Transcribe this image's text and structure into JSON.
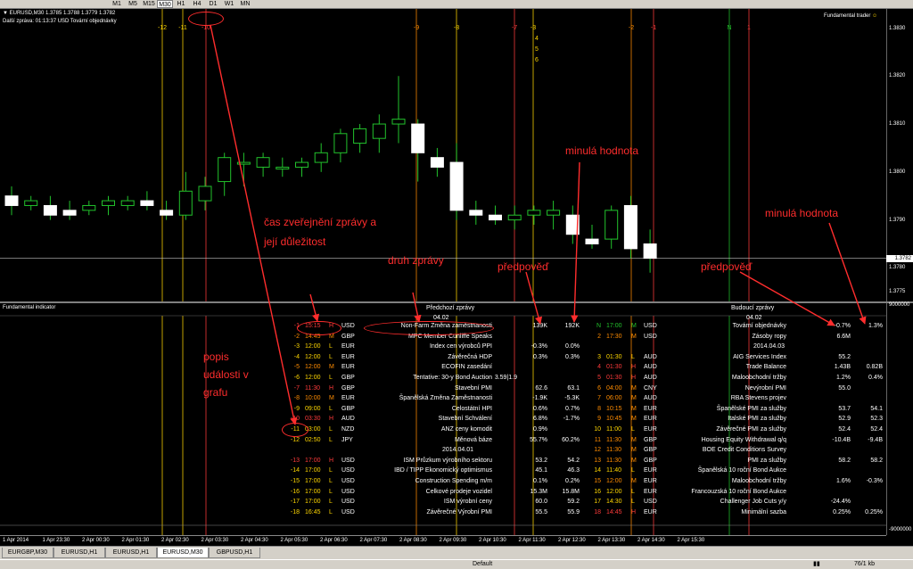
{
  "toolbar": {
    "timeframes": [
      "M1",
      "M5",
      "M15",
      "M30",
      "H1",
      "H4",
      "D1",
      "W1",
      "MN"
    ],
    "active": "M30"
  },
  "chart": {
    "symbol_line": "EURUSD,M30  1.3785 1.3788 1.3779 1.3782",
    "countdown_line": "Další zpráva: 01:13:37 USD Tovární objednávky",
    "ea_label": "Fundamental trader",
    "current_price": "1.3782",
    "y_labels": [
      "1.3830",
      "1.3820",
      "1.3810",
      "1.3800",
      "1.3790",
      "1.3780",
      "1.3775"
    ],
    "event_labels": [
      {
        "text": "-12",
        "color": "#ffd700"
      },
      {
        "text": "-11",
        "color": "#ffd700"
      },
      {
        "text": "-10",
        "color": "#ff3b3b"
      },
      {
        "text": "-9",
        "color": "#ff8c00"
      },
      {
        "text": "-8",
        "color": "#ffd700"
      },
      {
        "text": "-7",
        "color": "#ff3b3b"
      },
      {
        "text": "-3",
        "color": "#ffd700"
      },
      {
        "text": "-2",
        "color": "#ff8c00"
      },
      {
        "text": "-1",
        "color": "#ff3b3b"
      },
      {
        "text": "N",
        "color": "#22c22c"
      },
      {
        "text": "1",
        "color": "#ff3b3b"
      }
    ],
    "future_labels": [
      "4",
      "5",
      "6"
    ]
  },
  "indicator": {
    "title": "Fundamental indicator",
    "axis_top": "9000000",
    "axis_bottom": "-9000000",
    "header_prev": "Předchozí zprávy",
    "header_next": "Budoucí zprávy",
    "date_prev": "04.02",
    "date_next": "04.02",
    "date_mid_prev": "2014.04.01",
    "date_mid_next": "2014.04.03",
    "prev_rows": [
      {
        "n": "-1",
        "t": "15:15",
        "imp": "H",
        "cur": "USD",
        "name": "Non-Farm Změna zaměstnanosti",
        "a": "",
        "f": "139K",
        "p": "192K",
        "color": "#ff3b3b"
      },
      {
        "n": "-2",
        "t": "14:45",
        "imp": "M",
        "cur": "GBP",
        "name": "MPC Member Cunliffe Speaks",
        "a": "",
        "f": "",
        "p": "",
        "color": "#ff8c00"
      },
      {
        "n": "-3",
        "t": "12:00",
        "imp": "L",
        "cur": "EUR",
        "name": "Index cen výrobců PPI",
        "a": "",
        "f": "-0.3%",
        "p": "0.0%",
        "color": "#ffd700"
      },
      {
        "n": "-4",
        "t": "12:00",
        "imp": "L",
        "cur": "EUR",
        "name": "Závěrečná HDP",
        "a": "",
        "f": "0.3%",
        "p": "0.3%",
        "color": "#ffd700"
      },
      {
        "n": "-5",
        "t": "12:00",
        "imp": "M",
        "cur": "EUR",
        "name": "ECOFIN zasedání",
        "a": "",
        "f": "",
        "p": "",
        "color": "#ff8c00"
      },
      {
        "n": "-6",
        "t": "12:00",
        "imp": "L",
        "cur": "GBP",
        "name": "Tentative: 30-y Bond Auction",
        "a": "3.59|1.9",
        "f": "",
        "p": "",
        "color": "#ffd700"
      },
      {
        "n": "-7",
        "t": "11:30",
        "imp": "H",
        "cur": "GBP",
        "name": "Stavební PMI",
        "a": "",
        "f": "62.6",
        "p": "63.1",
        "color": "#ff3b3b"
      },
      {
        "n": "-8",
        "t": "10:00",
        "imp": "M",
        "cur": "EUR",
        "name": "Španělská Změna Zaměstnanosti",
        "a": "",
        "f": "-1.9K",
        "p": "-5.3K",
        "color": "#ff8c00"
      },
      {
        "n": "-9",
        "t": "09:00",
        "imp": "L",
        "cur": "GBP",
        "name": "Celostátní HPI",
        "a": "",
        "f": "0.6%",
        "p": "0.7%",
        "color": "#ffd700"
      },
      {
        "n": "-10",
        "t": "03:30",
        "imp": "H",
        "cur": "AUD",
        "name": "Stavební Schválení",
        "a": "",
        "f": "6.8%",
        "p": "-1.7%",
        "color": "#ff3b3b"
      },
      {
        "n": "-11",
        "t": "03:00",
        "imp": "L",
        "cur": "NZD",
        "name": "ANZ ceny komodit",
        "a": "",
        "f": "0.9%",
        "p": "",
        "color": "#ffd700"
      },
      {
        "n": "-12",
        "t": "02:50",
        "imp": "L",
        "cur": "JPY",
        "name": "Měnová báze",
        "a": "",
        "f": "55.7%",
        "p": "60.2%",
        "color": "#ffd700"
      },
      {
        "n": "-13",
        "t": "17:00",
        "imp": "H",
        "cur": "USD",
        "name": "ISM Průzkum výrobního sektoru",
        "a": "",
        "f": "53.2",
        "p": "54.2",
        "color": "#ff3b3b"
      },
      {
        "n": "-14",
        "t": "17:00",
        "imp": "L",
        "cur": "USD",
        "name": "IBD / TIPP Ekonomický optimismus",
        "a": "",
        "f": "45.1",
        "p": "46.3",
        "color": "#ffd700"
      },
      {
        "n": "-15",
        "t": "17:00",
        "imp": "L",
        "cur": "USD",
        "name": "Construction Spending m/m",
        "a": "",
        "f": "0.1%",
        "p": "0.2%",
        "color": "#ffd700"
      },
      {
        "n": "-16",
        "t": "17:00",
        "imp": "L",
        "cur": "USD",
        "name": "Celkové prodeje vozidel",
        "a": "",
        "f": "15.3M",
        "p": "15.8M",
        "color": "#ffd700"
      },
      {
        "n": "-17",
        "t": "17:00",
        "imp": "L",
        "cur": "USD",
        "name": "ISM výrobní ceny",
        "a": "",
        "f": "60.0",
        "p": "59.2",
        "color": "#ffd700"
      },
      {
        "n": "-18",
        "t": "16:45",
        "imp": "L",
        "cur": "USD",
        "name": "Závěrečné Výrobní PMI",
        "a": "",
        "f": "55.5",
        "p": "55.9",
        "color": "#ffd700"
      }
    ],
    "next_rows": [
      {
        "n": "N",
        "t": "17:00",
        "imp": "M",
        "cur": "USD",
        "name": "Tovární objednávky",
        "f": "-0.7%",
        "p": "1.3%",
        "color": "#22c22c"
      },
      {
        "n": "2",
        "t": "17:30",
        "imp": "M",
        "cur": "USD",
        "name": "Zásoby ropy",
        "f": "6.6M",
        "p": "",
        "color": "#ff8c00"
      },
      {
        "n": "3",
        "t": "01:30",
        "imp": "L",
        "cur": "AUD",
        "name": "AIG Services Index",
        "f": "55.2",
        "p": "",
        "color": "#ffd700"
      },
      {
        "n": "4",
        "t": "01:30",
        "imp": "H",
        "cur": "AUD",
        "name": "Trade Balance",
        "f": "1.43B",
        "p": "0.82B",
        "color": "#ff3b3b"
      },
      {
        "n": "5",
        "t": "01:30",
        "imp": "H",
        "cur": "AUD",
        "name": "Maloobchodní tržby",
        "f": "1.2%",
        "p": "0.4%",
        "color": "#ff3b3b"
      },
      {
        "n": "6",
        "t": "04:00",
        "imp": "M",
        "cur": "CNY",
        "name": "Nevýrobní PMI",
        "f": "55.0",
        "p": "",
        "color": "#ff8c00"
      },
      {
        "n": "7",
        "t": "06:00",
        "imp": "M",
        "cur": "AUD",
        "name": "RBA Stevens projev",
        "f": "",
        "p": "",
        "color": "#ff8c00"
      },
      {
        "n": "8",
        "t": "10:15",
        "imp": "M",
        "cur": "EUR",
        "name": "Španělské PMI za služby",
        "f": "53.7",
        "p": "54.1",
        "color": "#ff8c00"
      },
      {
        "n": "9",
        "t": "10:45",
        "imp": "M",
        "cur": "EUR",
        "name": "Italské PMI za služby",
        "f": "52.9",
        "p": "52.3",
        "color": "#ff8c00"
      },
      {
        "n": "10",
        "t": "11:00",
        "imp": "L",
        "cur": "EUR",
        "name": "Závěrečné PMI za služby",
        "f": "52.4",
        "p": "52.4",
        "color": "#ffd700"
      },
      {
        "n": "11",
        "t": "11:30",
        "imp": "M",
        "cur": "GBP",
        "name": "Housing Equity Withdrawal q/q",
        "f": "-10.4B",
        "p": "-9.4B",
        "color": "#ff8c00"
      },
      {
        "n": "12",
        "t": "11:30",
        "imp": "M",
        "cur": "GBP",
        "name": "BOE Credit Conditions Survey",
        "f": "",
        "p": "",
        "color": "#ff8c00"
      },
      {
        "n": "13",
        "t": "11:30",
        "imp": "M",
        "cur": "GBP",
        "name": "PMI za služby",
        "f": "58.2",
        "p": "58.2",
        "color": "#ff8c00"
      },
      {
        "n": "14",
        "t": "11:40",
        "imp": "L",
        "cur": "EUR",
        "name": "Španělská 10 roční Bond Aukce",
        "f": "",
        "p": "",
        "color": "#ffd700"
      },
      {
        "n": "15",
        "t": "12:00",
        "imp": "M",
        "cur": "EUR",
        "name": "Maloobchodní tržby",
        "f": "1.6%",
        "p": "-0.3%",
        "color": "#ff8c00"
      },
      {
        "n": "16",
        "t": "12:00",
        "imp": "L",
        "cur": "EUR",
        "name": "Francouzská 10 roční Bond Aukce",
        "f": "",
        "p": "",
        "color": "#ffd700"
      },
      {
        "n": "17",
        "t": "14:30",
        "imp": "L",
        "cur": "USD",
        "name": "Challenger Job Cuts y/y",
        "f": "-24.4%",
        "p": "",
        "color": "#ffd700"
      },
      {
        "n": "18",
        "t": "14:45",
        "imp": "H",
        "cur": "EUR",
        "name": "Minimální sazba",
        "f": "0.25%",
        "p": "0.25%",
        "color": "#ff3b3b"
      }
    ]
  },
  "time_labels": [
    "1 Apr 2014",
    "1 Apr 23:30",
    "2 Apr 00:30",
    "2 Apr 01:30",
    "2 Apr 02:30",
    "2 Apr 03:30",
    "2 Apr 04:30",
    "2 Apr 05:30",
    "2 Apr 06:30",
    "2 Apr 07:30",
    "2 Apr 08:30",
    "2 Apr 09:30",
    "2 Apr 10:30",
    "2 Apr 11:30",
    "2 Apr 12:30",
    "2 Apr 13:30",
    "2 Apr 14:30",
    "2 Apr 15:30"
  ],
  "tabs": [
    "EURGBP,M30",
    "EURUSD,H1",
    "EURUSD,H1",
    "EURUSD,M30",
    "GBPUSD,H1"
  ],
  "active_tab": "EURUSD,M30",
  "status": {
    "profile": "Default",
    "right": "76/1 kb"
  },
  "annotations": {
    "time_importance": "čas zveřejnění zprávy a její důležitost",
    "news_type": "druh zprávy",
    "forecast_left": "předpověď",
    "previous_left": "minulá hodnota",
    "forecast_right": "předpověď",
    "previous_right": "minulá hodnota",
    "event_desc": "popis události v grafu"
  },
  "chart_data": {
    "type": "candlestick",
    "symbol": "EURUSD",
    "timeframe": "M30",
    "ohlc_last": {
      "open": 1.3785,
      "high": 1.3788,
      "low": 1.3779,
      "close": 1.3782
    },
    "candles": [
      {
        "o": 1.3795,
        "h": 1.3797,
        "l": 1.3791,
        "c": 1.3793
      },
      {
        "o": 1.3793,
        "h": 1.3795,
        "l": 1.3792,
        "c": 1.3794
      },
      {
        "o": 1.3793,
        "h": 1.3795,
        "l": 1.379,
        "c": 1.3791
      },
      {
        "o": 1.3792,
        "h": 1.3794,
        "l": 1.379,
        "c": 1.3791
      },
      {
        "o": 1.3792,
        "h": 1.3794,
        "l": 1.3791,
        "c": 1.3793
      },
      {
        "o": 1.3793,
        "h": 1.3795,
        "l": 1.3791,
        "c": 1.3794
      },
      {
        "o": 1.3793,
        "h": 1.3795,
        "l": 1.3792,
        "c": 1.3794
      },
      {
        "o": 1.3794,
        "h": 1.3796,
        "l": 1.3792,
        "c": 1.3793
      },
      {
        "o": 1.3792,
        "h": 1.3794,
        "l": 1.379,
        "c": 1.3791
      },
      {
        "o": 1.3791,
        "h": 1.38,
        "l": 1.379,
        "c": 1.3796
      },
      {
        "o": 1.3794,
        "h": 1.3799,
        "l": 1.3792,
        "c": 1.3797
      },
      {
        "o": 1.3798,
        "h": 1.3804,
        "l": 1.3795,
        "c": 1.3803
      },
      {
        "o": 1.3802,
        "h": 1.3804,
        "l": 1.3797,
        "c": 1.3802
      },
      {
        "o": 1.3801,
        "h": 1.3804,
        "l": 1.3799,
        "c": 1.3803
      },
      {
        "o": 1.3801,
        "h": 1.3803,
        "l": 1.3799,
        "c": 1.3801
      },
      {
        "o": 1.3801,
        "h": 1.3803,
        "l": 1.3799,
        "c": 1.3802
      },
      {
        "o": 1.3802,
        "h": 1.3806,
        "l": 1.38,
        "c": 1.3804
      },
      {
        "o": 1.3804,
        "h": 1.3809,
        "l": 1.3802,
        "c": 1.3808
      },
      {
        "o": 1.3806,
        "h": 1.381,
        "l": 1.3804,
        "c": 1.3809
      },
      {
        "o": 1.3807,
        "h": 1.3812,
        "l": 1.3804,
        "c": 1.381
      },
      {
        "o": 1.381,
        "h": 1.382,
        "l": 1.3806,
        "c": 1.3811
      },
      {
        "o": 1.381,
        "h": 1.3811,
        "l": 1.3798,
        "c": 1.3804
      },
      {
        "o": 1.3803,
        "h": 1.3805,
        "l": 1.3799,
        "c": 1.3801
      },
      {
        "o": 1.3802,
        "h": 1.3806,
        "l": 1.379,
        "c": 1.3792
      },
      {
        "o": 1.3792,
        "h": 1.3794,
        "l": 1.3789,
        "c": 1.3791
      },
      {
        "o": 1.3791,
        "h": 1.3793,
        "l": 1.3789,
        "c": 1.379
      },
      {
        "o": 1.379,
        "h": 1.3793,
        "l": 1.3788,
        "c": 1.3791
      },
      {
        "o": 1.3791,
        "h": 1.3793,
        "l": 1.3789,
        "c": 1.3792
      },
      {
        "o": 1.3791,
        "h": 1.3794,
        "l": 1.3788,
        "c": 1.3792
      },
      {
        "o": 1.3791,
        "h": 1.3793,
        "l": 1.3785,
        "c": 1.3787
      },
      {
        "o": 1.3786,
        "h": 1.3789,
        "l": 1.3784,
        "c": 1.3785
      },
      {
        "o": 1.3786,
        "h": 1.3793,
        "l": 1.3784,
        "c": 1.3792
      },
      {
        "o": 1.3793,
        "h": 1.3795,
        "l": 1.3782,
        "c": 1.3784
      },
      {
        "o": 1.3785,
        "h": 1.3788,
        "l": 1.3779,
        "c": 1.3782
      }
    ],
    "y_range": [
      1.3773,
      1.3834
    ]
  }
}
